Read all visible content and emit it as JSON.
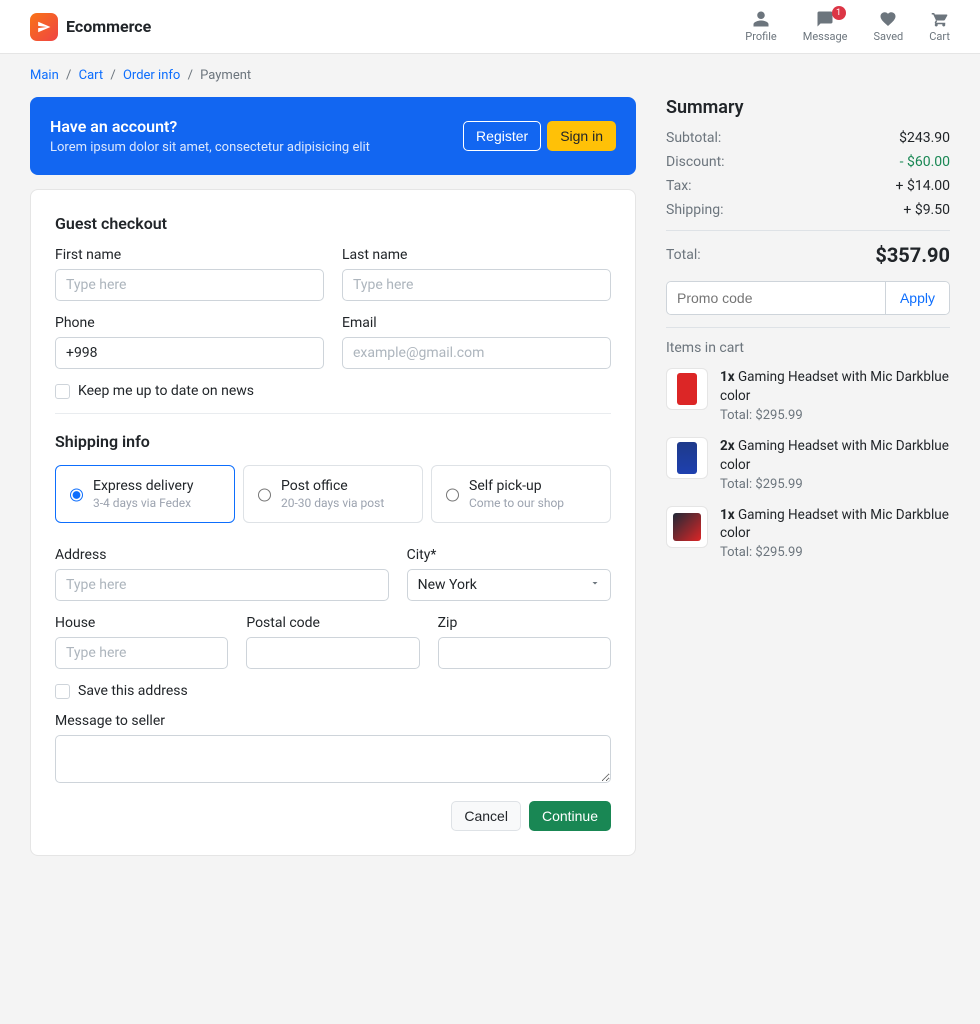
{
  "header": {
    "brand": "Ecommerce",
    "nav": {
      "profile": "Profile",
      "message": "Message",
      "message_badge": "1",
      "saved": "Saved",
      "cart": "Cart"
    }
  },
  "breadcrumb": {
    "main": "Main",
    "cart": "Cart",
    "order": "Order info",
    "payment": "Payment"
  },
  "account": {
    "title": "Have an account?",
    "subtitle": "Lorem ipsum dolor sit amet, consectetur adipisicing elit",
    "register": "Register",
    "signin": "Sign in"
  },
  "guest": {
    "title": "Guest checkout",
    "first_name_label": "First name",
    "first_name_ph": "Type here",
    "last_name_label": "Last name",
    "last_name_ph": "Type here",
    "phone_label": "Phone",
    "phone_value": "+998",
    "email_label": "Email",
    "email_ph": "example@gmail.com",
    "keep_updated": "Keep me up to date on news"
  },
  "shipping": {
    "title": "Shipping info",
    "options": [
      {
        "title": "Express delivery",
        "sub": "3-4 days via Fedex"
      },
      {
        "title": "Post office",
        "sub": "20-30 days via post"
      },
      {
        "title": "Self pick-up",
        "sub": "Come to our shop"
      }
    ],
    "address_label": "Address",
    "address_ph": "Type here",
    "city_label": "City*",
    "city_value": "New York",
    "house_label": "House",
    "house_ph": "Type here",
    "postal_label": "Postal code",
    "zip_label": "Zip",
    "save_address": "Save this address",
    "message_label": "Message to seller",
    "cancel": "Cancel",
    "continue": "Continue"
  },
  "summary": {
    "title": "Summary",
    "subtotal_label": "Subtotal:",
    "subtotal": "$243.90",
    "discount_label": "Discount:",
    "discount": "- $60.00",
    "tax_label": "Tax:",
    "tax": "+ $14.00",
    "shipping_label": "Shipping:",
    "shipping": "+ $9.50",
    "total_label": "Total:",
    "total": "$357.90",
    "promo_ph": "Promo code",
    "apply": "Apply",
    "items_title": "Items in cart",
    "items": [
      {
        "qty": "1x",
        "name": "Gaming Headset with Mic Darkblue color",
        "total": "Total: $295.99",
        "thumb": "red-phone"
      },
      {
        "qty": "2x",
        "name": "Gaming Headset with Mic Darkblue color",
        "total": "Total: $295.99",
        "thumb": "blue-phone"
      },
      {
        "qty": "1x",
        "name": "Gaming Headset with Mic Darkblue color",
        "total": "Total: $295.99",
        "thumb": "tablet"
      }
    ]
  }
}
